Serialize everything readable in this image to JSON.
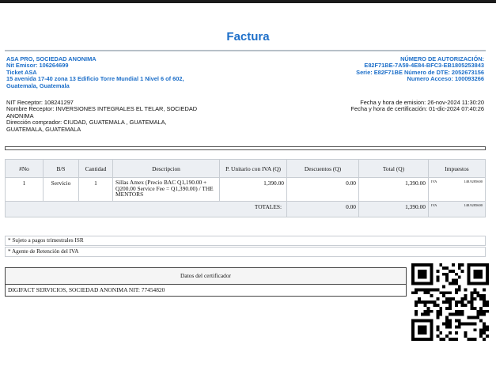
{
  "title": "Factura",
  "emisor": {
    "name": "ASA PRO, SOCIEDAD ANONIMA",
    "nit": "Nit Emisor: 106264699",
    "ticket": "Ticket ASA",
    "address_1": "15 avenida 17-40 zona 13 Edificio Torre Mundial 1 Nivel 6 of 602,",
    "address_2": "Guatemala, Guatemala"
  },
  "autorizacion": {
    "label": "NÚMERO DE AUTORIZACIÓN:",
    "number": "E82F71BE-7A59-4E84-BFC3-EB1805253843",
    "serie": "Serie: E82F71BE Número de DTE: 2052673156",
    "acceso": "Numero Acceso: 100093266"
  },
  "receptor": {
    "nit": "NIT Receptor: 108241297",
    "name_1": "Nombre Receptor: INVERSIONES INTEGRALES EL TELAR, SOCIEDAD",
    "name_2": "ANONIMA",
    "dir_1": "Dirección comprador: CIUDAD, GUATEMALA , GUATEMALA,",
    "dir_2": "GUATEMALA, GUATEMALA"
  },
  "fechas": {
    "emision": "Fecha y hora de emision: 26-nov-2024 11:30:20",
    "certificacion": "Fecha y hora de certificación: 01-dic-2024 07:40:26"
  },
  "table": {
    "headers": [
      "#No",
      "B/S",
      "Cantidad",
      "Descripcion",
      "P. Unitario con IVA (Q)",
      "Descuentos (Q)",
      "Total (Q)",
      "Impuestos"
    ],
    "row": {
      "no": "1",
      "bs": "Servicio",
      "cantidad": "1",
      "descripcion": "Sillas Amex (Precio BAC Q1,190.00 + Q200.00 Service Fee = Q1,390.00) / THE MENTORS",
      "unitario": "1,390.00",
      "descuento": "0.00",
      "total": "1,390.00",
      "imp_name": "IVA",
      "imp_value": "148.9285600"
    },
    "totales": {
      "label": "TOTALES:",
      "descuento": "0.00",
      "total": "1,390.00",
      "imp_name": "IVA",
      "imp_value": "148.9285600"
    }
  },
  "notes": [
    "* Sujeto a pagos trimestrales ISR",
    "* Agente de Retención del IVA"
  ],
  "certificador": {
    "header": "Datos del certificador",
    "body": "DIGIFACT SERVICIOS, SOCIEDAD ANONIMA  NIT: 77454820"
  }
}
